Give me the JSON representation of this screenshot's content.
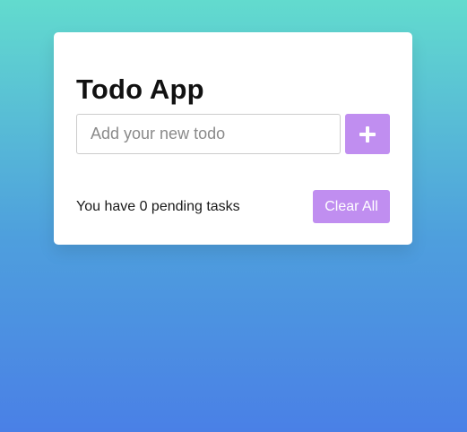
{
  "app": {
    "title": "Todo App"
  },
  "input": {
    "placeholder": "Add your new todo",
    "value": ""
  },
  "add_button": {
    "icon": "plus-icon"
  },
  "footer": {
    "pending_text": "You have 0 pending tasks",
    "clear_label": "Clear All"
  },
  "colors": {
    "accent": "#c08ef0",
    "background_top": "#62dbce",
    "background_bottom": "#4a80e6",
    "card": "#ffffff"
  }
}
